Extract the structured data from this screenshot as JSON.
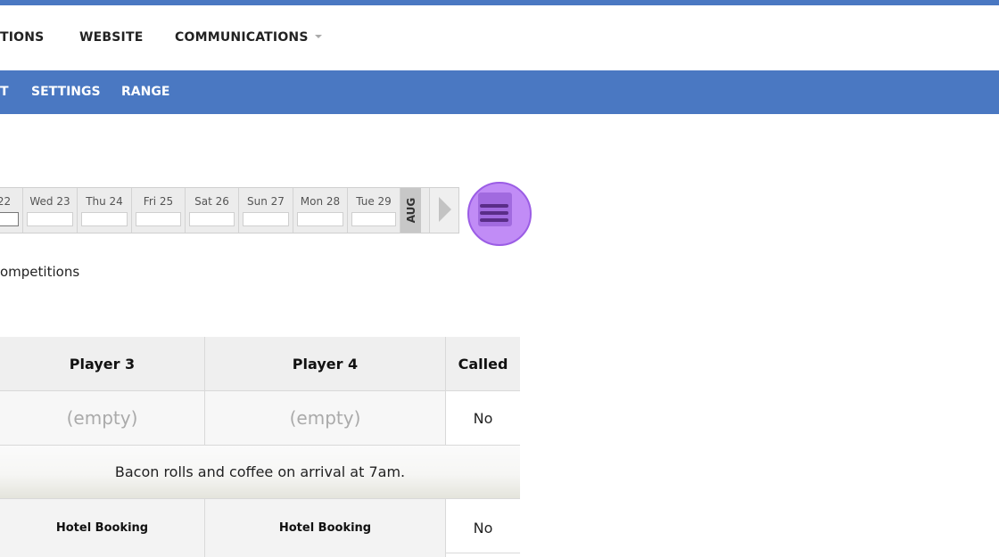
{
  "nav": {
    "items": [
      {
        "label": "TIONS"
      },
      {
        "label": "WEBSITE"
      },
      {
        "label": "COMMUNICATIONS"
      }
    ]
  },
  "subnav": {
    "items": [
      {
        "label": "T"
      },
      {
        "label": "SETTINGS"
      },
      {
        "label": "RANGE"
      }
    ]
  },
  "calendar": {
    "days": [
      {
        "label": "22"
      },
      {
        "label": "Wed 23"
      },
      {
        "label": "Thu 24"
      },
      {
        "label": "Fri 25"
      },
      {
        "label": "Sat 26"
      },
      {
        "label": "Sun 27"
      },
      {
        "label": "Mon 28"
      },
      {
        "label": "Tue 29"
      }
    ],
    "month": "AUG"
  },
  "competitions_text": "ompetitions",
  "table": {
    "headers": [
      "Player 3",
      "Player 4",
      "Called"
    ],
    "row1": {
      "player3": "(empty)",
      "player4": "(empty)",
      "called": "No"
    },
    "note": "Bacon rolls and coffee on arrival at 7am.",
    "row3": {
      "player3": "Hotel Booking",
      "player4": "Hotel Booking",
      "called": "No"
    }
  },
  "icons": {
    "menu": "hamburger-menu-icon",
    "next": "chevron-right-icon",
    "dropdown": "caret-down-icon"
  },
  "colors": {
    "primary": "#4a78c2",
    "highlight": "#b678f5"
  }
}
